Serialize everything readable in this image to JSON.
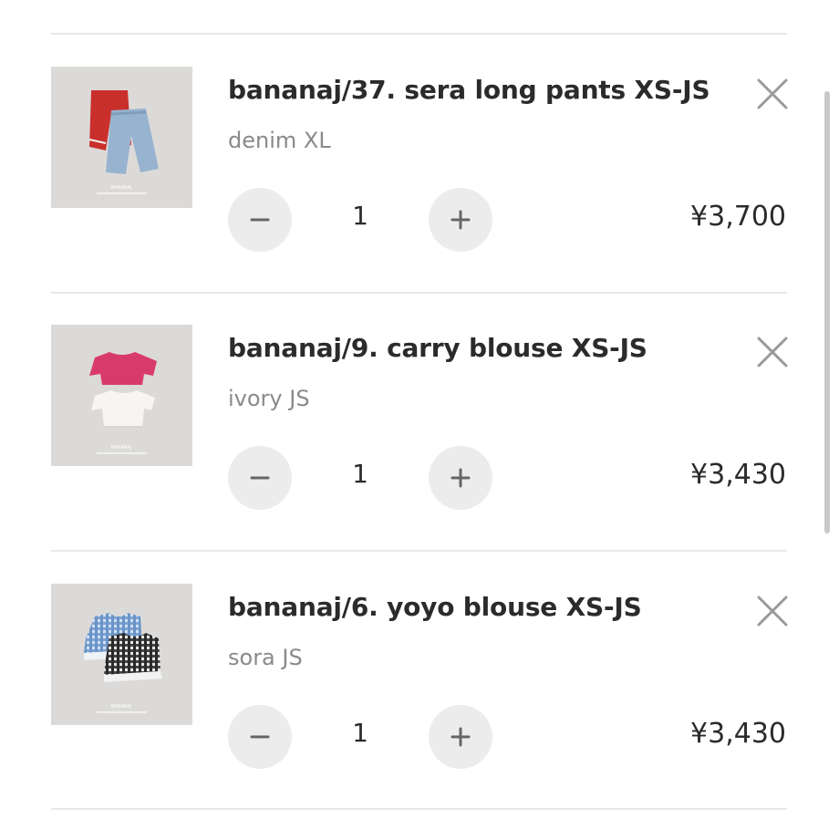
{
  "items": [
    {
      "title": "bananaj/37. sera long pants XS-JS",
      "variant": "denim XL",
      "quantity": "1",
      "price": "¥3,700",
      "thumbnail": "red-and-denim-pants-photo"
    },
    {
      "title": "bananaj/9. carry blouse XS-JS",
      "variant": "ivory JS",
      "quantity": "1",
      "price": "¥3,430",
      "thumbnail": "pink-and-white-blouse-photo"
    },
    {
      "title": "bananaj/6. yoyo blouse XS-JS",
      "variant": "sora JS",
      "quantity": "1",
      "price": "¥3,430",
      "thumbnail": "blue-and-black-gingham-blouse-photo"
    }
  ],
  "icons": {
    "remove": "close-icon",
    "decrease": "minus-icon",
    "increase": "plus-icon"
  },
  "colors": {
    "text": "#2b2b2b",
    "muted": "#8a8a8a",
    "button_bg": "#ececec",
    "divider": "#e8e8e8",
    "thumb_bg": "#dcdad8"
  }
}
